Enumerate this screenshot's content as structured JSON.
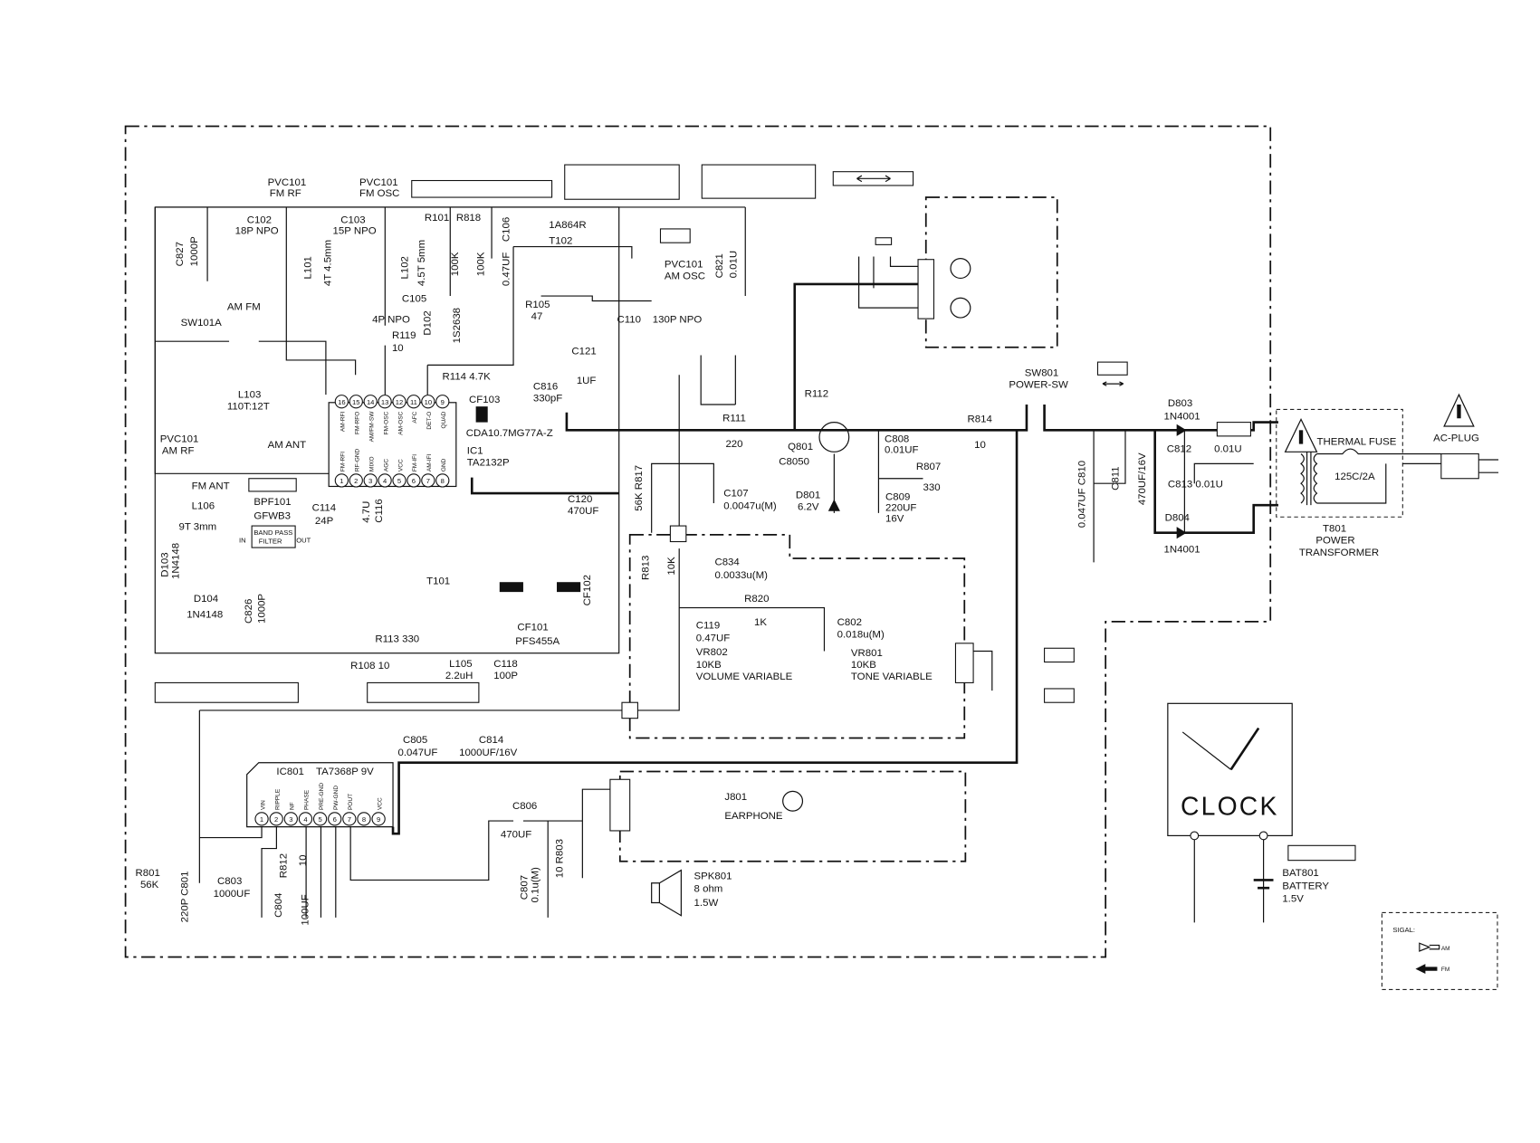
{
  "title_boxes": [
    "",
    "",
    "",
    ""
  ],
  "rf_section": {
    "pvc101_fm_rf": [
      "PVC101",
      "FM RF"
    ],
    "pvc101_fm_osc": [
      "PVC101",
      "FM OSC"
    ],
    "c827": [
      "C827",
      "1000P"
    ],
    "c102": [
      "C102",
      "18P NPO"
    ],
    "l101": [
      "L101",
      "4T 4.5mm"
    ],
    "c103": [
      "C103",
      "15P NPO"
    ],
    "l102": [
      "L102",
      "4.5T 5mm"
    ],
    "c105": [
      "C105",
      "4P NPO"
    ],
    "d102": [
      "D102",
      "1S2638"
    ],
    "r101": "R101",
    "r818": "R818",
    "r101_val": "100K",
    "r818_val": "100K",
    "c106": [
      "C106",
      "0.47UF"
    ],
    "t102": [
      "1A864R",
      "T102"
    ],
    "pvc101_am_osc": [
      "PVC101",
      "AM OSC"
    ],
    "c821": [
      "C821",
      "0.01U"
    ],
    "r105": [
      "R105",
      "47"
    ],
    "c110": [
      "C110",
      "130P NPO"
    ],
    "sw101a": [
      "AM FM",
      "SW101A"
    ],
    "r119": [
      "R119",
      "10"
    ],
    "r114": "R114 4.7K",
    "c121": [
      "C121",
      "1UF"
    ],
    "c816": [
      "C816",
      "330pF"
    ],
    "cf103": [
      "CF103",
      "CDA10.7MG77A-Z"
    ],
    "ic1": [
      "IC1",
      "TA2132P"
    ],
    "ic1_pins_top": [
      {
        "n": "16",
        "name": "AM-RFI"
      },
      {
        "n": "15",
        "name": "FM-RFO"
      },
      {
        "n": "14",
        "name": "AM/FM-SW"
      },
      {
        "n": "13",
        "name": "FM-OSC"
      },
      {
        "n": "12",
        "name": "AM-OSC"
      },
      {
        "n": "11",
        "name": "AFC"
      },
      {
        "n": "10",
        "name": "DET-O"
      },
      {
        "n": "9",
        "name": "QUAD"
      }
    ],
    "ic1_pins_bottom": [
      {
        "n": "1",
        "name": "FM-RFI"
      },
      {
        "n": "2",
        "name": "RF-GND"
      },
      {
        "n": "3",
        "name": "MIXO"
      },
      {
        "n": "4",
        "name": "AGC"
      },
      {
        "n": "5",
        "name": "VCC"
      },
      {
        "n": "6",
        "name": "FM-IFI"
      },
      {
        "n": "7",
        "name": "AM-IFI"
      },
      {
        "n": "8",
        "name": "GND"
      }
    ],
    "l103": [
      "L103",
      "110T:12T"
    ],
    "pvc101_am_rf": [
      "PVC101",
      "AM RF"
    ],
    "am_ant": "AM ANT",
    "fm_ant": "FM ANT",
    "bpf101": [
      "BPF101",
      "GFWB3"
    ],
    "bpf_body": [
      "BAND PASS",
      "FILTER"
    ],
    "bpf_in": "IN",
    "bpf_out": "OUT",
    "c114": [
      "C114",
      "24P"
    ],
    "l106": [
      "L106",
      "9T 3mm"
    ],
    "d103": [
      "D103",
      "1N4148"
    ],
    "d104": [
      "D104",
      "1N4148"
    ],
    "c826": [
      "C826",
      "1000P"
    ],
    "c116": [
      "C116",
      "4.7U"
    ],
    "t101": "T101",
    "c120": [
      "C120",
      "470UF"
    ],
    "cf102": "CF102",
    "cf101": [
      "CF101",
      "PFS455A"
    ],
    "r113": "R113 330",
    "r108": "R108 10",
    "l105": [
      "L105",
      "2.2uH"
    ],
    "c118": [
      "C118",
      "100P"
    ]
  },
  "power_section": {
    "r112": "R112",
    "r111": [
      "R111",
      "220"
    ],
    "q801": [
      "Q801",
      "C8050"
    ],
    "c808": [
      "C808",
      "0.01UF"
    ],
    "r807": [
      "R807",
      "330"
    ],
    "c809": [
      "C809",
      "220UF",
      "16V"
    ],
    "d801": [
      "D801",
      "6.2V"
    ],
    "r814": [
      "R814",
      "10"
    ],
    "sw801": [
      "SW801",
      "POWER-SW"
    ],
    "c810": "0.047UF C810",
    "c811": "C811",
    "c811_val": "470UF/16V",
    "d803": [
      "D803",
      "1N4001"
    ],
    "c812": "C812",
    "c812_val": "0.01U",
    "c813": "C813  0.01U",
    "d804": [
      "D804",
      "1N4001"
    ],
    "thermal_fuse": "THERMAL FUSE",
    "fuse_rating": "125C/2A",
    "ac_plug": "AC-PLUG",
    "t801": [
      "T801",
      "POWER",
      "TRANSFORMER"
    ]
  },
  "audio_section": {
    "r817": "56K R817",
    "c107": [
      "C107",
      "0.0047u(M)"
    ],
    "r813": [
      "R813",
      "10K"
    ],
    "c834": [
      "C834",
      "0.0033u(M)"
    ],
    "r820": [
      "R820",
      "1K"
    ],
    "c119": [
      "C119",
      "0.47UF"
    ],
    "vr802": [
      "VR802",
      "10KB",
      "VOLUME VARIABLE"
    ],
    "c802": [
      "C802",
      "0.018u(M)"
    ],
    "vr801": [
      "VR801",
      "10KB",
      "TONE VARIABLE"
    ],
    "c805": [
      "C805",
      "0.047UF"
    ],
    "c814": [
      "C814",
      "1000UF/16V"
    ],
    "ic801": [
      "IC801",
      "TA7368P 9V"
    ],
    "ic801_pins": [
      {
        "n": "1",
        "name": "VIN"
      },
      {
        "n": "2",
        "name": "RIPPLE"
      },
      {
        "n": "3",
        "name": "NF"
      },
      {
        "n": "4",
        "name": "PHASE"
      },
      {
        "n": "5",
        "name": "PRE-GND"
      },
      {
        "n": "6",
        "name": "PW-GND"
      },
      {
        "n": "7",
        "name": "POUT"
      },
      {
        "n": "8",
        "name": ""
      },
      {
        "n": "9",
        "name": "VCC"
      }
    ],
    "c806": [
      "C806",
      "470UF"
    ],
    "c807": [
      "C807",
      "0.1u(M)"
    ],
    "r803": "10 R803",
    "j801": [
      "J801",
      "EARPHONE"
    ],
    "spk801": [
      "SPK801",
      "8 ohm",
      "1.5W"
    ],
    "r801": [
      "R801",
      "56K"
    ],
    "c801": [
      "C801",
      "220P"
    ],
    "c803": [
      "C803",
      "1000UF"
    ],
    "r812": [
      "R812",
      "10"
    ],
    "c804": [
      "C804",
      "100UF"
    ]
  },
  "clock": {
    "label": "CLOCK",
    "bat801": [
      "BAT801",
      "BATTERY",
      "1.5V"
    ]
  },
  "legend": {
    "title": "SIGAL:",
    "am": "AM",
    "fm": "FM"
  }
}
